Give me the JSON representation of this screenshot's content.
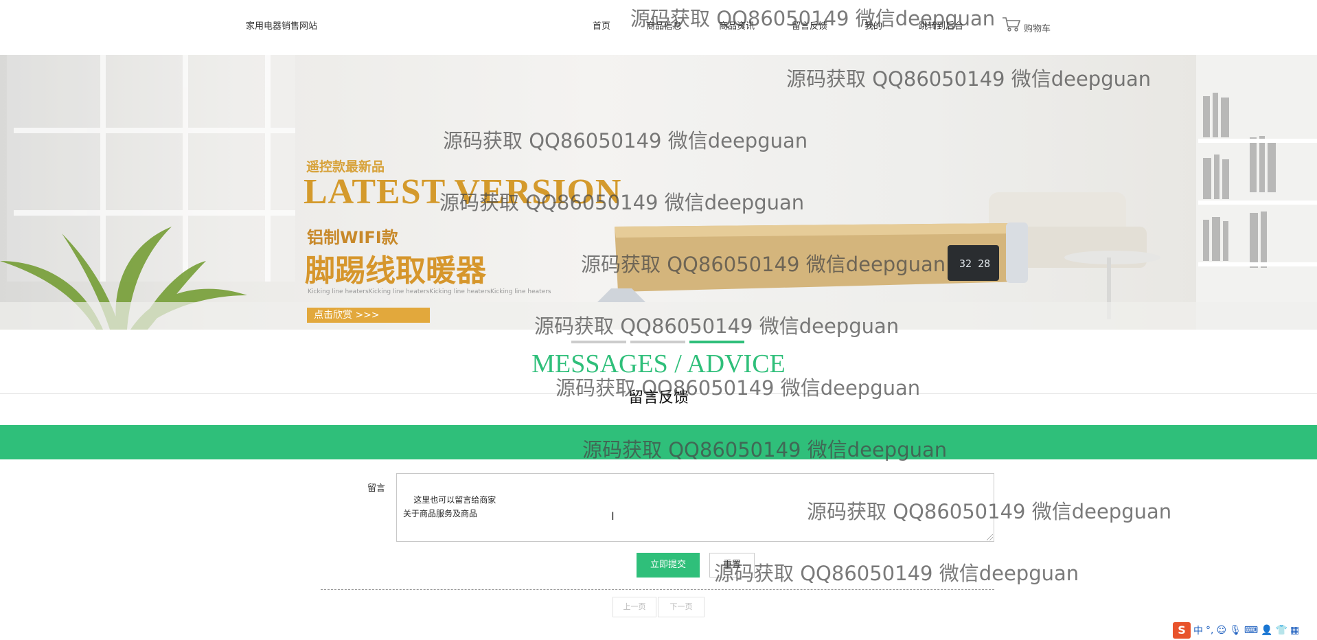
{
  "header": {
    "site_title": "家用电器销售网站",
    "nav": [
      {
        "label": "首页"
      },
      {
        "label": "商品信息"
      },
      {
        "label": "商品资讯"
      },
      {
        "label": "留言反馈"
      },
      {
        "label": "我的"
      },
      {
        "label": "跳转到后台"
      }
    ],
    "cart_label": "购物车"
  },
  "banner": {
    "tag": "遥控款最新品",
    "headline": "LATEST VERSION",
    "sub1": "铝制WIFI款",
    "sub2": "脚踢线取暖器",
    "fine_print": "Kicking line heatersKicking line heatersKicking line heatersKicking line heaters",
    "cta": "点击欣赏 >>>",
    "display": "32 28",
    "slides_total": 3,
    "active_slide": 3
  },
  "section": {
    "title_en": "MESSAGES / ADVICE",
    "title_cn": "留言反馈"
  },
  "form": {
    "label": "留言",
    "textarea_value": "这里也可以留言给商家\n关于商品服务及商品",
    "submit_label": "立即提交",
    "reset_label": "重置"
  },
  "pagination": {
    "prev_label": "上一页",
    "next_label": "下一页"
  },
  "watermark": "源码获取 QQ86050149 微信deepguan",
  "ime": {
    "logo": "S",
    "mode": "中",
    "punct": "°,"
  },
  "colors": {
    "accent_green": "#2fbf7a",
    "banner_gold": "#d49a2c"
  }
}
